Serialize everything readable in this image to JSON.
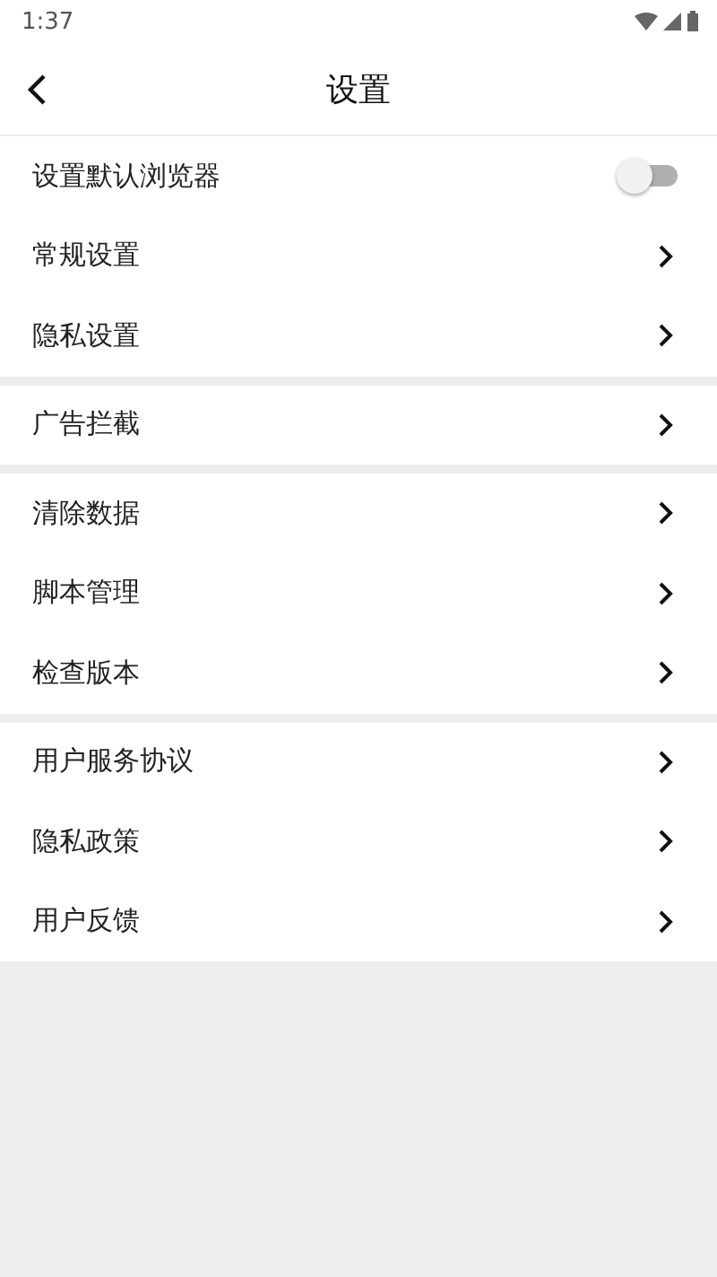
{
  "status_bar": {
    "time": "1:37"
  },
  "header": {
    "title": "设置"
  },
  "sections": [
    {
      "items": [
        {
          "kind": "toggle",
          "label": "设置默认浏览器",
          "on": false
        },
        {
          "kind": "link",
          "label": "常规设置"
        },
        {
          "kind": "link",
          "label": "隐私设置"
        }
      ]
    },
    {
      "items": [
        {
          "kind": "link",
          "label": "广告拦截"
        }
      ]
    },
    {
      "items": [
        {
          "kind": "link",
          "label": "清除数据"
        },
        {
          "kind": "link",
          "label": "脚本管理"
        },
        {
          "kind": "link",
          "label": "检查版本"
        }
      ]
    },
    {
      "items": [
        {
          "kind": "link",
          "label": "用户服务协议"
        },
        {
          "kind": "link",
          "label": "隐私政策"
        },
        {
          "kind": "link",
          "label": "用户反馈"
        }
      ]
    }
  ]
}
